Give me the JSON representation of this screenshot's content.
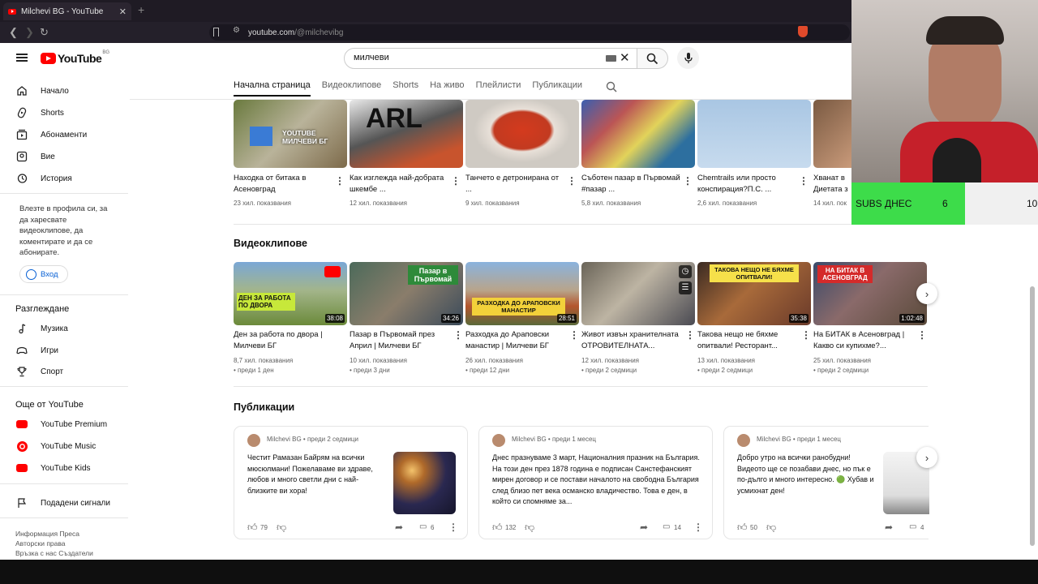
{
  "browser": {
    "tab_title": "Milchevi BG - YouTube",
    "url_host": "youtube.com",
    "url_path": "/@milchevibg"
  },
  "header": {
    "logo": "YouTube",
    "country": "BG",
    "search_value": "милчеви"
  },
  "sidebar": {
    "items": [
      {
        "label": "Начало",
        "icon": "home-icon"
      },
      {
        "label": "Shorts",
        "icon": "shorts-icon"
      },
      {
        "label": "Абонаменти",
        "icon": "subscriptions-icon"
      },
      {
        "label": "Вие",
        "icon": "you-icon"
      },
      {
        "label": "История",
        "icon": "history-icon"
      }
    ],
    "signin_text": "Влезте в профила си, за да харесвате видеоклипове, да коментирате и да се абонирате.",
    "signin_button": "Вход",
    "explore_title": "Разглеждане",
    "explore": [
      {
        "label": "Музика",
        "icon": "music-icon"
      },
      {
        "label": "Игри",
        "icon": "gaming-icon"
      },
      {
        "label": "Спорт",
        "icon": "trophy-icon"
      }
    ],
    "more_title": "Още от YouTube",
    "more": [
      {
        "label": "YouTube Premium"
      },
      {
        "label": "YouTube Music"
      },
      {
        "label": "YouTube Kids"
      }
    ],
    "report": "Подадени сигнали",
    "footer1": "Информация  Преса",
    "footer2": "Авторски права",
    "footer3": "Връзка с нас  Създатели"
  },
  "channel_tabs": [
    "Начална страница",
    "Видеоклипове",
    "Shorts",
    "На живо",
    "Плейлисти",
    "Публикации"
  ],
  "top_row": [
    {
      "title": "Находка от битака в Асеновград",
      "views": "23 хил. показвания"
    },
    {
      "title": "Как изглежда най-добрата шкембе ...",
      "views": "12 хил. показвания"
    },
    {
      "title": "Танчето е детронирана от ...",
      "views": "9 хил. показвания"
    },
    {
      "title": "Съботен пазар в Първомай #пазар ...",
      "views": "5,8 хил. показвания"
    },
    {
      "title": "Chemtrails или просто конспирация?П.С. ...",
      "views": "2,6 хил. показвания"
    },
    {
      "title": "Хванат в Диетата з",
      "views": "14 хил. пок"
    }
  ],
  "videos_section": {
    "title": "Видеоклипове",
    "items": [
      {
        "title": "Ден за работа по двора | Милчеви БГ",
        "views": "8,7 хил. показвания",
        "age": "• преди 1 ден",
        "duration": "38:08"
      },
      {
        "title": "Пазар в Първомай през Април | Милчеви БГ",
        "views": "10 хил. показвания",
        "age": "• преди 3 дни",
        "duration": "34:26"
      },
      {
        "title": "Разходка до Араповски манастир | Милчеви БГ",
        "views": "26 хил. показвания",
        "age": "• преди 12 дни",
        "duration": "28:51"
      },
      {
        "title": "Живот извън хранителната ОТРОВИТЕЛНАТА...",
        "views": "12 хил. показвания",
        "age": "• преди 2 седмици",
        "duration": ""
      },
      {
        "title": "Такова нещо не бяхме опитвали! Ресторант...",
        "views": "13 хил. показвания",
        "age": "• преди 2 седмици",
        "duration": "35:38"
      },
      {
        "title": "На БИТАК в Асеновград | Какво си купихме?...",
        "views": "25 хил. показвания",
        "age": "• преди 2 седмици",
        "duration": "1:02:48"
      }
    ]
  },
  "posts_section": {
    "title": "Публикации",
    "items": [
      {
        "author": "Milchevi BG",
        "age": "преди 2 седмици",
        "text": "Честит Рамазан Байрям на всички мюсюлмани! Пожелаваме ви здраве, любов и много светли дни с най-близките ви хора!",
        "likes": "79",
        "comments": "6"
      },
      {
        "author": "Milchevi BG",
        "age": "преди 1 месец",
        "text": "Днес празнуваме 3 март, Националния празник на България. На този ден през 1878 година е подписан Санстефанският мирен договор и се постави началото на свободна България след близо пет века османско владичество. Това е ден, в който си спомняме за...",
        "likes": "132",
        "comments": "14"
      },
      {
        "author": "Milchevi BG",
        "age": "преди 1 месец",
        "text": "Добро утро на всички ранобудни! Видеото ще се позабави днес, но пък е по-дълго и много интересно. 🟢 Хубав и усмихнат ден!",
        "likes": "50",
        "comments": "4"
      }
    ]
  },
  "overlay": {
    "subs_label": "SUBS ДНЕС",
    "subs_value": "6",
    "right_value": "10"
  },
  "thumb_text": {
    "t1": "YOUTUBE МИЛЧЕВИ БГ",
    "t2": "ARL",
    "v1": "ДЕН ЗА РАБОТА ПО ДВОРА",
    "v2": "Пазар в Първомай",
    "v3": "РАЗХОДКА ДО АРАПОВСКИ МАНАСТИР",
    "v5": "ТАКОВА НЕЩО НЕ БЯХМЕ ОПИТВАЛИ!",
    "v6": "НА БИТАК В АСЕНОВГРАД"
  }
}
